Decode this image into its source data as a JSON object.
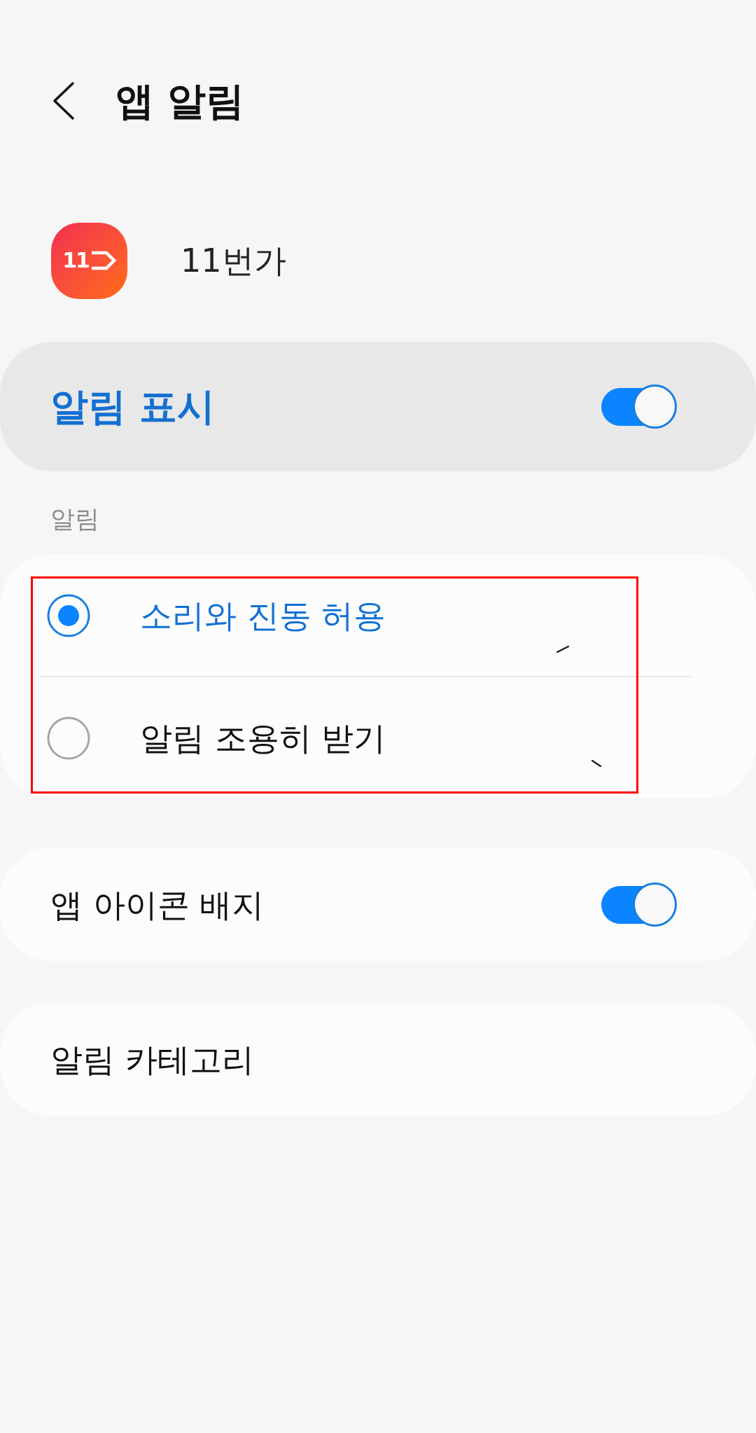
{
  "header": {
    "title": "앱 알림"
  },
  "app": {
    "logo_text": "11",
    "name": "11번가"
  },
  "show_notifications": {
    "label": "알림 표시",
    "on": true
  },
  "notifications": {
    "section_label": "알림",
    "highlighted": true,
    "options": [
      {
        "label": "소리와 진동 허용",
        "selected": true
      },
      {
        "label": "알림 조용히 받기",
        "selected": false
      }
    ]
  },
  "settings": [
    {
      "kind": "toggle",
      "label": "앱 아이콘 배지",
      "on": true
    },
    {
      "kind": "link",
      "label": "알림 카테고리"
    }
  ]
}
